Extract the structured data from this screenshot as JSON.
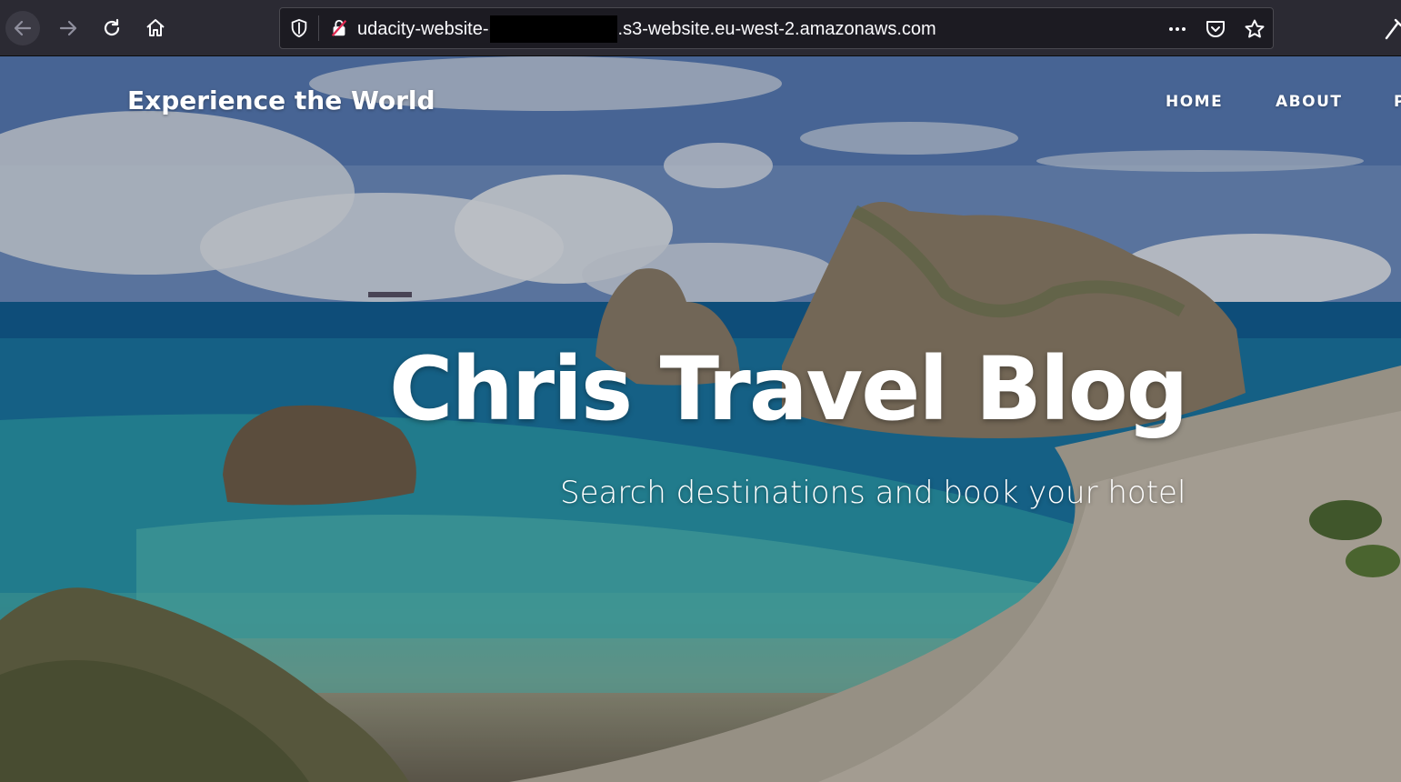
{
  "browser": {
    "url_prefix": "udacity-website-",
    "url_suffix": ".s3-website.eu-west-2.amazonaws.com",
    "icons": {
      "back": "arrow-left-icon",
      "forward": "arrow-right-icon",
      "reload": "reload-icon",
      "home": "home-icon",
      "tracking": "shield-icon",
      "security": "insecure-lock-icon",
      "more": "more-dots-icon",
      "pocket": "pocket-icon",
      "bookmark": "star-icon"
    }
  },
  "site": {
    "brand": "Experience the World",
    "nav": [
      "HOME",
      "ABOUT",
      "P"
    ],
    "hero": {
      "title": "Chris Travel Blog",
      "subtitle": "Search destinations and book your hotel"
    }
  },
  "colors": {
    "toolbar_bg": "#2b2a33",
    "urlbar_bg": "#1c1b22",
    "sea": "#1b7fa6",
    "text": "#ffffff"
  }
}
